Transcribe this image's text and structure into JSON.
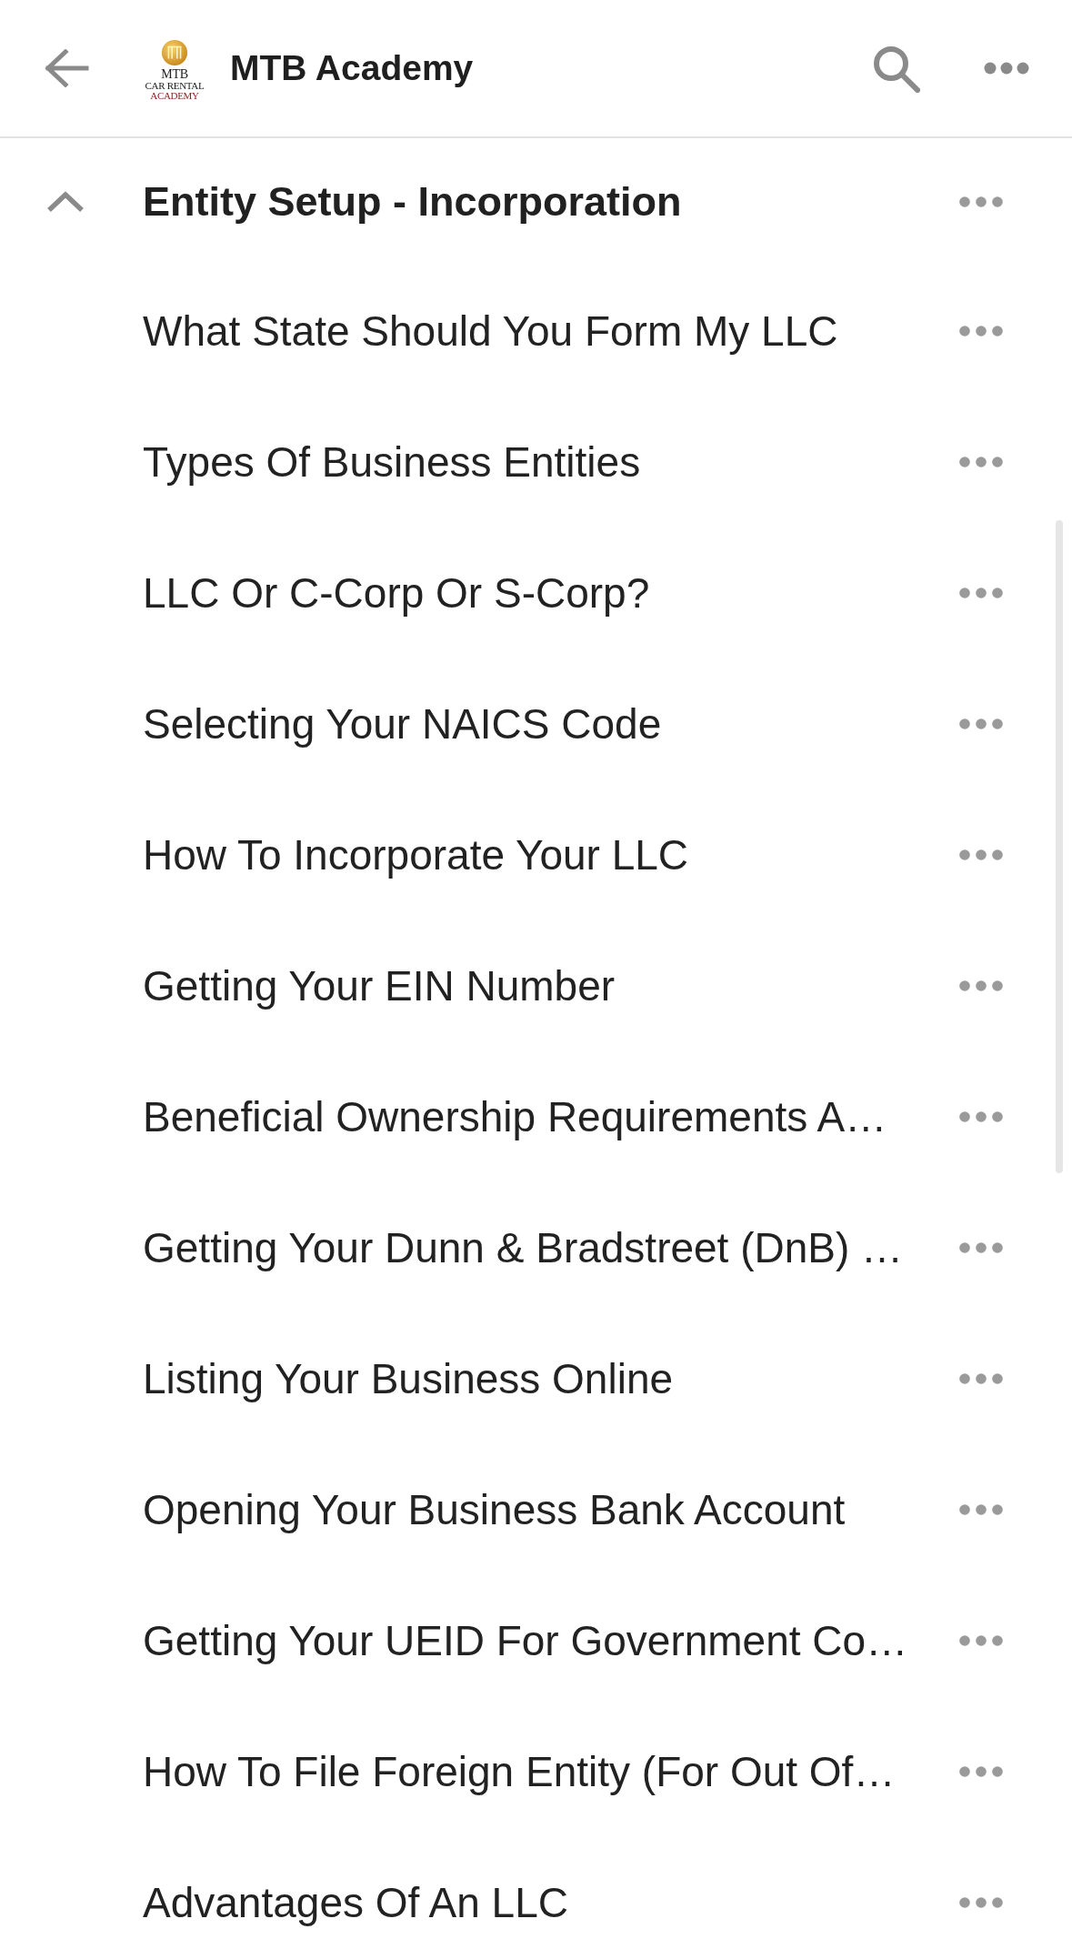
{
  "app_bar": {
    "logo": {
      "lines": [
        "MTB",
        "CAR RENTAL",
        "ACADEMY"
      ]
    },
    "title": "MTB Academy"
  },
  "section": {
    "title": "Entity Setup - Incorporation",
    "expanded": true,
    "lessons": [
      {
        "title": "What State Should You Form My LLC"
      },
      {
        "title": "Types Of Business Entities"
      },
      {
        "title": "LLC Or C-Corp Or S-Corp?"
      },
      {
        "title": "Selecting Your NAICS Code"
      },
      {
        "title": "How To Incorporate Your LLC"
      },
      {
        "title": "Getting Your EIN Number"
      },
      {
        "title": "Beneficial Ownership Requirements A…"
      },
      {
        "title": "Getting Your Dunn & Bradstreet (DnB) …"
      },
      {
        "title": "Listing Your Business Online"
      },
      {
        "title": "Opening Your Business Bank Account"
      },
      {
        "title": "Getting Your UEID For Government Co…"
      },
      {
        "title": "How To File Foreign Entity (For Out Of…"
      },
      {
        "title": "Advantages Of An LLC"
      }
    ]
  }
}
